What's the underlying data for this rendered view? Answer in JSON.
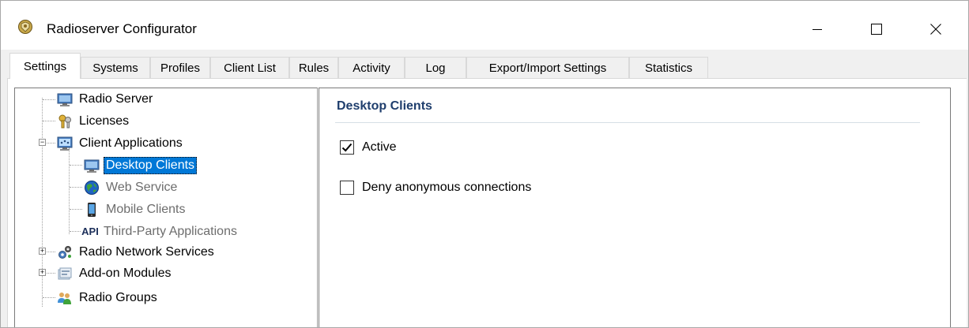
{
  "window": {
    "title": "Radioserver Configurator",
    "controls": {
      "minimize": "minimize-icon",
      "maximize": "maximize-icon",
      "close": "close-icon"
    }
  },
  "tabs": [
    {
      "label": "Settings",
      "active": true
    },
    {
      "label": "Systems",
      "active": false
    },
    {
      "label": "Profiles",
      "active": false
    },
    {
      "label": "Client List",
      "active": false
    },
    {
      "label": "Rules",
      "active": false
    },
    {
      "label": "Activity",
      "active": false
    },
    {
      "label": "Log",
      "active": false
    },
    {
      "label": "Export/Import Settings",
      "active": false
    },
    {
      "label": "Statistics",
      "active": false
    }
  ],
  "tree": {
    "items": [
      {
        "label": "Radio Server",
        "icon": "monitor-icon",
        "state": "normal"
      },
      {
        "label": "Licenses",
        "icon": "license-keys-icon",
        "state": "normal"
      },
      {
        "label": "Client Applications",
        "icon": "network-computers-icon",
        "state": "normal",
        "expanded": true
      },
      {
        "label": "Desktop Clients",
        "icon": "desktop-client-icon",
        "state": "selected"
      },
      {
        "label": "Web Service",
        "icon": "globe-icon",
        "state": "disabled"
      },
      {
        "label": "Mobile Clients",
        "icon": "mobile-phone-icon",
        "state": "disabled"
      },
      {
        "label": "Third-Party Applications",
        "icon": "api-icon",
        "icon_text": "API",
        "state": "disabled"
      },
      {
        "label": "Radio Network Services",
        "icon": "gear-network-icon",
        "state": "normal",
        "expanded": false
      },
      {
        "label": "Add-on Modules",
        "icon": "modules-icon",
        "state": "normal",
        "expanded": false
      },
      {
        "label": "Radio Groups",
        "icon": "users-group-icon",
        "state": "normal"
      }
    ]
  },
  "details": {
    "title": "Desktop Clients",
    "options": [
      {
        "label": "Active",
        "checked": true
      },
      {
        "label": "Deny anonymous connections",
        "checked": false
      }
    ]
  },
  "colors": {
    "selection": "#0078d7",
    "section_title": "#1f3e6d",
    "disabled_text": "#6d6d6d"
  }
}
